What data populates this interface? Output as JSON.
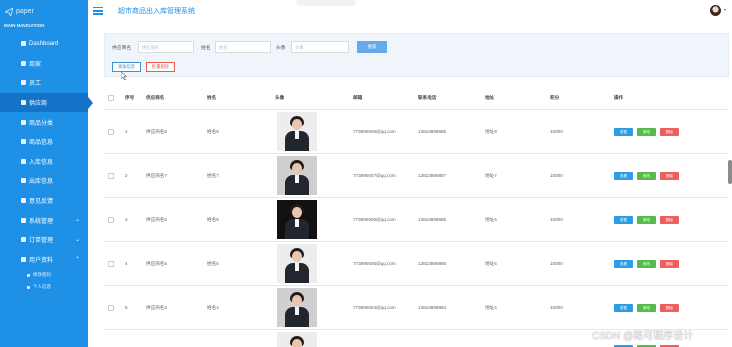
{
  "brand": {
    "logo_text": "paper"
  },
  "nav": {
    "header": "MAIN NAVIGATION",
    "items": [
      {
        "label": "Dashboard",
        "icon": "home-icon"
      },
      {
        "label": "商家",
        "icon": "grid-icon"
      },
      {
        "label": "员工",
        "icon": "grid-icon"
      },
      {
        "label": "供应商",
        "icon": "comment-icon",
        "active": true
      },
      {
        "label": "商品分类",
        "icon": "comment-icon"
      },
      {
        "label": "商品信息",
        "icon": "grid-icon"
      },
      {
        "label": "入库信息",
        "icon": "grid-icon"
      },
      {
        "label": "出库信息",
        "icon": "grid-icon"
      },
      {
        "label": "意见反馈",
        "icon": "flag-icon"
      },
      {
        "label": "系统管理",
        "icon": "list-icon",
        "expand": "chevron-down"
      },
      {
        "label": "订单管理",
        "icon": "list-icon",
        "expand": "chevron-down"
      },
      {
        "label": "用户资料",
        "icon": "list-icon",
        "expand": "chevron-up"
      }
    ],
    "subitems": [
      {
        "label": "修改密码"
      },
      {
        "label": "个人信息"
      }
    ]
  },
  "topbar": {
    "title": "超市商品出入库管理系统"
  },
  "search": {
    "supplier_label": "供应商名",
    "supplier_placeholder": "供应商名",
    "name_label": "姓名",
    "name_placeholder": "姓名",
    "avatar_label": "头像",
    "avatar_placeholder": "头像",
    "search_button": "搜索",
    "add_button": "添加信息",
    "batch_delete_button": "批量删除"
  },
  "table": {
    "columns": [
      "",
      "序号",
      "供应商名",
      "姓名",
      "头像",
      "邮箱",
      "联系电话",
      "地址",
      "积分",
      "操作"
    ],
    "actions": {
      "view": "查看",
      "edit": "修改",
      "delete": "删除"
    },
    "rows": [
      {
        "no": "1",
        "supplier": "供应商名8",
        "name": "姓名8",
        "email": "773890008@qq.com",
        "phone": "13823888888",
        "address": "地址8",
        "points": "10000"
      },
      {
        "no": "2",
        "supplier": "供应商名7",
        "name": "姓名7",
        "email": "773890007@qq.com",
        "phone": "13823888887",
        "address": "地址7",
        "points": "10000"
      },
      {
        "no": "3",
        "supplier": "供应商名6",
        "name": "姓名6",
        "email": "773890006@qq.com",
        "phone": "13823888886",
        "address": "地址6",
        "points": "10000"
      },
      {
        "no": "4",
        "supplier": "供应商名5",
        "name": "姓名5",
        "email": "773890005@qq.com",
        "phone": "13823888885",
        "address": "地址5",
        "points": "10000"
      },
      {
        "no": "5",
        "supplier": "供应商名4",
        "name": "姓名4",
        "email": "773890004@qq.com",
        "phone": "13823888884",
        "address": "地址4",
        "points": "10000"
      }
    ]
  },
  "watermark": "CSDN @路可程序设计",
  "colors": {
    "sidebar": "#1e90e6",
    "view": "#2d9ce8",
    "edit": "#55b94c",
    "delete": "#ee5f5b"
  }
}
